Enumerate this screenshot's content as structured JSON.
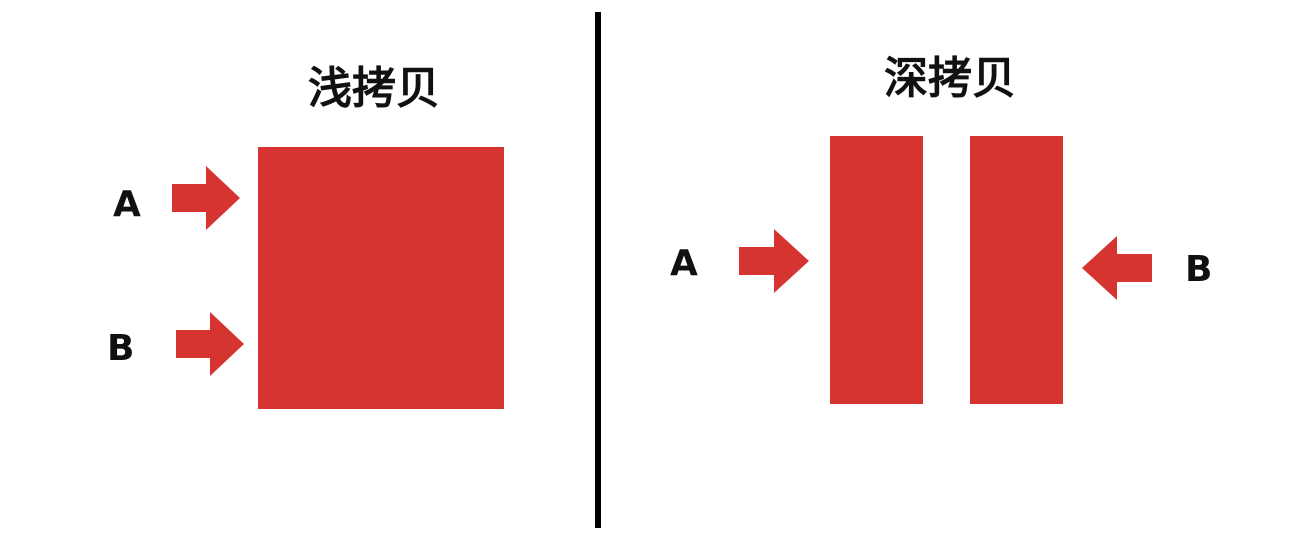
{
  "shallow_copy": {
    "title": "浅拷贝",
    "pointer_a_label": "A",
    "pointer_b_label": "B"
  },
  "deep_copy": {
    "title": "深拷贝",
    "pointer_a_label": "A",
    "pointer_b_label": "B"
  },
  "colors": {
    "block": "#d63431",
    "arrow": "#d63431",
    "divider": "#000000",
    "text": "#111111"
  },
  "icons": {
    "arrow_right": "arrow-right-icon",
    "arrow_left": "arrow-left-icon"
  }
}
